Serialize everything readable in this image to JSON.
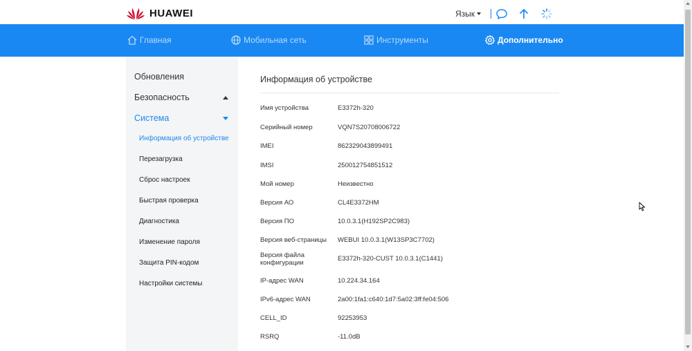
{
  "header": {
    "brand": "HUAWEI",
    "language_label": "Язык",
    "icons": [
      "message-icon",
      "upload-icon",
      "loading-icon"
    ]
  },
  "nav": {
    "items": [
      {
        "label": "Главная",
        "icon": "home-icon"
      },
      {
        "label": "Мобильная сеть",
        "icon": "globe-icon"
      },
      {
        "label": "Инструменты",
        "icon": "tools-icon"
      },
      {
        "label": "Дополнительно",
        "icon": "gear-icon"
      }
    ]
  },
  "sidebar": {
    "updates": "Обновления",
    "security": "Безопасность",
    "system": "Система",
    "sub_items": [
      "Информация об устройстве",
      "Перезагрузка",
      "Сброс настроек",
      "Быстрая проверка",
      "Диагностика",
      "Изменение пароля",
      "Защита PIN-кодом",
      "Настройки системы"
    ]
  },
  "main": {
    "title": "Информация об устройстве",
    "rows": [
      {
        "label": "Имя устройства",
        "value": "E3372h-320"
      },
      {
        "label": "Серийный номер",
        "value": "VQN7S20708006722"
      },
      {
        "label": "IMEI",
        "value": "862329043899491"
      },
      {
        "label": "IMSI",
        "value": "250012754851512"
      },
      {
        "label": "Мой номер",
        "value": "Неизвестно"
      },
      {
        "label": "Версия АО",
        "value": "CL4E3372HM"
      },
      {
        "label": "Версия ПО",
        "value": "10.0.3.1(H192SP2C983)"
      },
      {
        "label": "Версия веб-страницы",
        "value": "WEBUI 10.0.3.1(W13SP3C7702)"
      },
      {
        "label": "Версия файла конфигурации",
        "value": "E3372h-320-CUST 10.0.3.1(C1441)"
      },
      {
        "label": "IP-адрес WAN",
        "value": "10.224.34.164"
      },
      {
        "label": "IPv6-адрес WAN",
        "value": "2a00:1fa1:c640:1d7:5a02:3ff:fe04:506"
      },
      {
        "label": "CELL_ID",
        "value": "92253953"
      },
      {
        "label": "RSRQ",
        "value": "-11.0dB"
      }
    ]
  },
  "colors": {
    "accent": "#1a88f2",
    "brand_red": "#cf0a2c"
  }
}
